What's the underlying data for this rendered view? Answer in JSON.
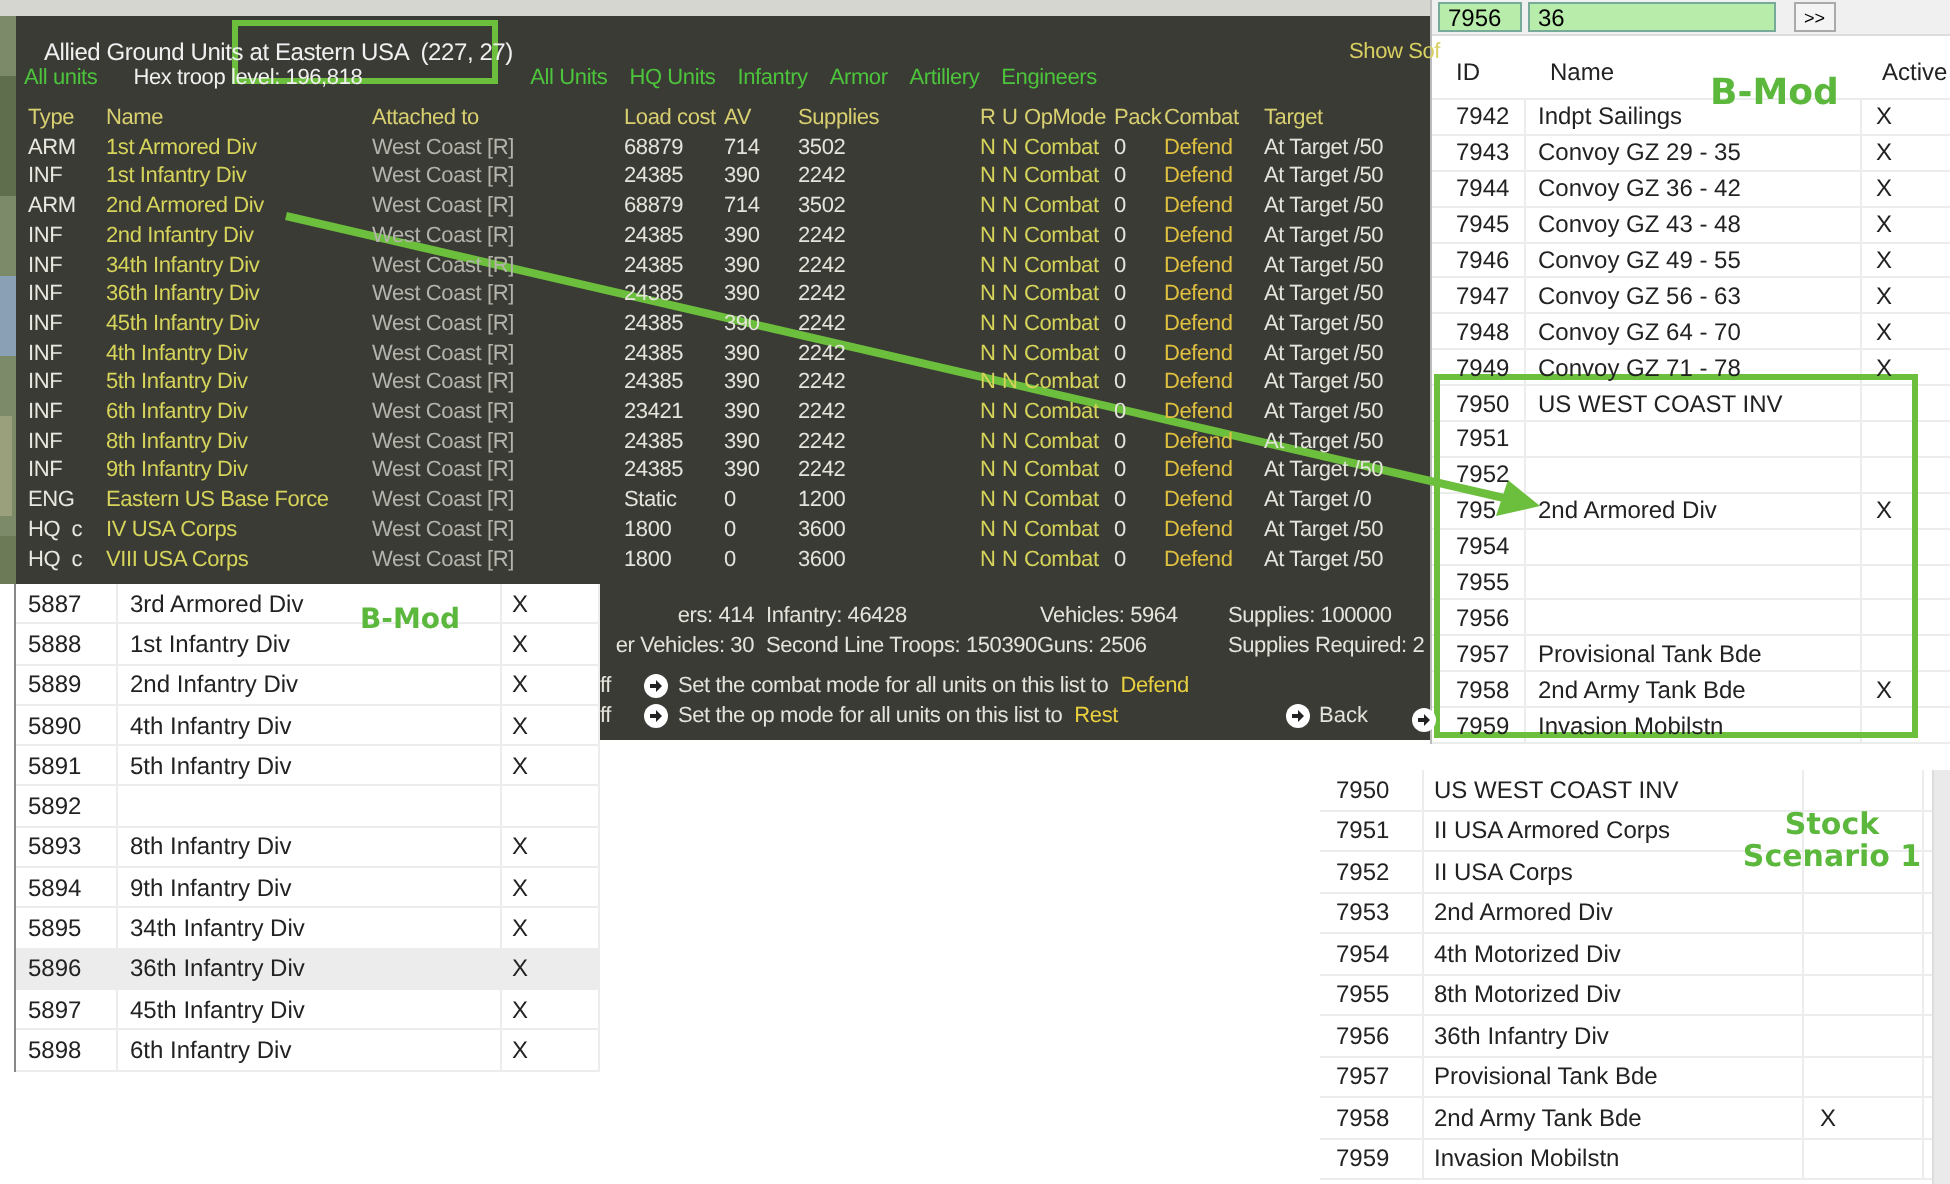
{
  "game_window": {
    "title": "Allied Ground Units at Eastern USA  (227, 27)",
    "unit_filter": "All units",
    "hex_troop_level": "Hex troop level: 196,818",
    "show_soft": "Show Sof",
    "filters": [
      "All Units",
      "HQ Units",
      "Infantry",
      "Armor",
      "Artillery",
      "Engineers"
    ],
    "columns": [
      "Type",
      "Name",
      "Attached to",
      "Load cost",
      "AV",
      "Supplies",
      "R",
      "U",
      "OpMode",
      "Pack",
      "Combat",
      "Target"
    ],
    "rows": [
      [
        "ARM",
        "1st Armored Div",
        "West Coast [R]",
        "68879",
        "714",
        "3502",
        "N",
        "N",
        "Combat",
        "0",
        "Defend",
        "At Target /50"
      ],
      [
        "INF",
        "1st Infantry Div",
        "West Coast [R]",
        "24385",
        "390",
        "2242",
        "N",
        "N",
        "Combat",
        "0",
        "Defend",
        "At Target /50"
      ],
      [
        "ARM",
        "2nd Armored Div",
        "West Coast [R]",
        "68879",
        "714",
        "3502",
        "N",
        "N",
        "Combat",
        "0",
        "Defend",
        "At Target /50"
      ],
      [
        "INF",
        "2nd Infantry Div",
        "West Coast [R]",
        "24385",
        "390",
        "2242",
        "N",
        "N",
        "Combat",
        "0",
        "Defend",
        "At Target /50"
      ],
      [
        "INF",
        "34th Infantry Div",
        "West Coast [R]",
        "24385",
        "390",
        "2242",
        "N",
        "N",
        "Combat",
        "0",
        "Defend",
        "At Target /50"
      ],
      [
        "INF",
        "36th Infantry Div",
        "West Coast [R]",
        "24385",
        "390",
        "2242",
        "N",
        "N",
        "Combat",
        "0",
        "Defend",
        "At Target /50"
      ],
      [
        "INF",
        "45th Infantry Div",
        "West Coast [R]",
        "24385",
        "390",
        "2242",
        "N",
        "N",
        "Combat",
        "0",
        "Defend",
        "At Target /50"
      ],
      [
        "INF",
        "4th Infantry Div",
        "West Coast [R]",
        "24385",
        "390",
        "2242",
        "N",
        "N",
        "Combat",
        "0",
        "Defend",
        "At Target /50"
      ],
      [
        "INF",
        "5th Infantry Div",
        "West Coast [R]",
        "24385",
        "390",
        "2242",
        "N",
        "N",
        "Combat",
        "0",
        "Defend",
        "At Target /50"
      ],
      [
        "INF",
        "6th Infantry Div",
        "West Coast [R]",
        "23421",
        "390",
        "2242",
        "N",
        "N",
        "Combat",
        "0",
        "Defend",
        "At Target /50"
      ],
      [
        "INF",
        "8th Infantry Div",
        "West Coast [R]",
        "24385",
        "390",
        "2242",
        "N",
        "N",
        "Combat",
        "0",
        "Defend",
        "At Target /50"
      ],
      [
        "INF",
        "9th Infantry Div",
        "West Coast [R]",
        "24385",
        "390",
        "2242",
        "N",
        "N",
        "Combat",
        "0",
        "Defend",
        "At Target /50"
      ],
      [
        "ENG",
        "Eastern US Base Force",
        "West Coast [R]",
        "Static",
        "0",
        "1200",
        "N",
        "N",
        "Combat",
        "0",
        "Defend",
        "At Target /0"
      ],
      [
        "HQ  c",
        "IV USA Corps",
        "West Coast [R]",
        "1800",
        "0",
        "3600",
        "N",
        "N",
        "Combat",
        "0",
        "Defend",
        "At Target /50"
      ],
      [
        "HQ  c",
        "VIII USA Corps",
        "West Coast [R]",
        "1800",
        "0",
        "3600",
        "N",
        "N",
        "Combat",
        "0",
        "Defend",
        "At Target /50"
      ]
    ],
    "totals": [
      [
        "ers: 414",
        "Infantry: 46428",
        "Vehicles: 5964",
        "Supplies: 100000"
      ],
      [
        "er Vehicles: 30",
        "Second Line Troops: 150390Guns: 2506",
        "Supplies Required: 2"
      ]
    ],
    "commands": [
      {
        "toggle": "ff",
        "text": "Set the combat mode for all units on this list to",
        "value": "Defend"
      },
      {
        "toggle": "ff",
        "text": "Set the op mode for all units on this list to",
        "value": "Rest"
      }
    ],
    "back_button": "Back"
  },
  "bmod_list": {
    "label": "B-Mod",
    "rows": [
      {
        "id": "5887",
        "name": "3rd Armored Div",
        "active": "X",
        "selected": false
      },
      {
        "id": "5888",
        "name": "1st Infantry Div",
        "active": "X",
        "selected": false
      },
      {
        "id": "5889",
        "name": "2nd Infantry Div",
        "active": "X",
        "selected": false
      },
      {
        "id": "5890",
        "name": "4th Infantry Div",
        "active": "X",
        "selected": false
      },
      {
        "id": "5891",
        "name": "5th Infantry Div",
        "active": "X",
        "selected": false
      },
      {
        "id": "5892",
        "selected": false
      },
      {
        "id": "5893",
        "name": "8th Infantry Div",
        "active": "X",
        "selected": false
      },
      {
        "id": "5894",
        "name": "9th Infantry Div",
        "active": "X",
        "selected": false
      },
      {
        "id": "5895",
        "name": "34th Infantry Div",
        "active": "X",
        "selected": false
      },
      {
        "id": "5896",
        "name": "36th Infantry Div",
        "active": "X",
        "selected": true
      },
      {
        "id": "5897",
        "name": "45th Infantry Div",
        "active": "X",
        "selected": false
      },
      {
        "id": "5898",
        "name": "6th Infantry Div",
        "active": "X",
        "selected": false
      }
    ]
  },
  "bmod_editor": {
    "id_field": "7956",
    "name_field": "36",
    "next_button": ">>",
    "label": "B-Mod",
    "columns": [
      "ID",
      "Name",
      "Active"
    ],
    "rows": [
      {
        "id": "7942",
        "name": "Indpt Sailings",
        "active": "X"
      },
      {
        "id": "7943",
        "name": "Convoy GZ 29 - 35",
        "active": "X"
      },
      {
        "id": "7944",
        "name": "Convoy GZ 36 - 42",
        "active": "X"
      },
      {
        "id": "7945",
        "name": "Convoy GZ 43 - 48",
        "active": "X"
      },
      {
        "id": "7946",
        "name": "Convoy GZ 49 - 55",
        "active": "X"
      },
      {
        "id": "7947",
        "name": "Convoy GZ 56 - 63",
        "active": "X"
      },
      {
        "id": "7948",
        "name": "Convoy GZ 64 - 70",
        "active": "X"
      },
      {
        "id": "7949",
        "name": "Convoy GZ 71 - 78",
        "active": "X"
      },
      {
        "id": "7950",
        "name": "US WEST COAST INV"
      },
      {
        "id": "7951"
      },
      {
        "id": "7952"
      },
      {
        "id": "795",
        "name": "2nd Armored Div",
        "active": "X"
      },
      {
        "id": "7954"
      },
      {
        "id": "7955"
      },
      {
        "id": "7956"
      },
      {
        "id": "7957",
        "name": "Provisional Tank Bde"
      },
      {
        "id": "7958",
        "name": "2nd Army Tank Bde",
        "active": "X"
      },
      {
        "id": "7959",
        "name": "Invasion Mobilstn"
      }
    ]
  },
  "stock_list": {
    "label": "Stock Scenario 1",
    "rows": [
      {
        "id": "7950",
        "name": "US WEST COAST INV"
      },
      {
        "id": "7951",
        "name": "II USA Armored Corps"
      },
      {
        "id": "7952",
        "name": "II USA Corps"
      },
      {
        "id": "7953",
        "name": "2nd Armored Div"
      },
      {
        "id": "7954",
        "name": "4th Motorized Div"
      },
      {
        "id": "7955",
        "name": "8th Motorized Div"
      },
      {
        "id": "7956",
        "name": "36th Infantry Div"
      },
      {
        "id": "7957",
        "name": "Provisional Tank Bde"
      },
      {
        "id": "7958",
        "name": "2nd Army Tank Bde",
        "active": "X"
      },
      {
        "id": "7959",
        "name": "Invasion Mobilstn"
      }
    ]
  }
}
